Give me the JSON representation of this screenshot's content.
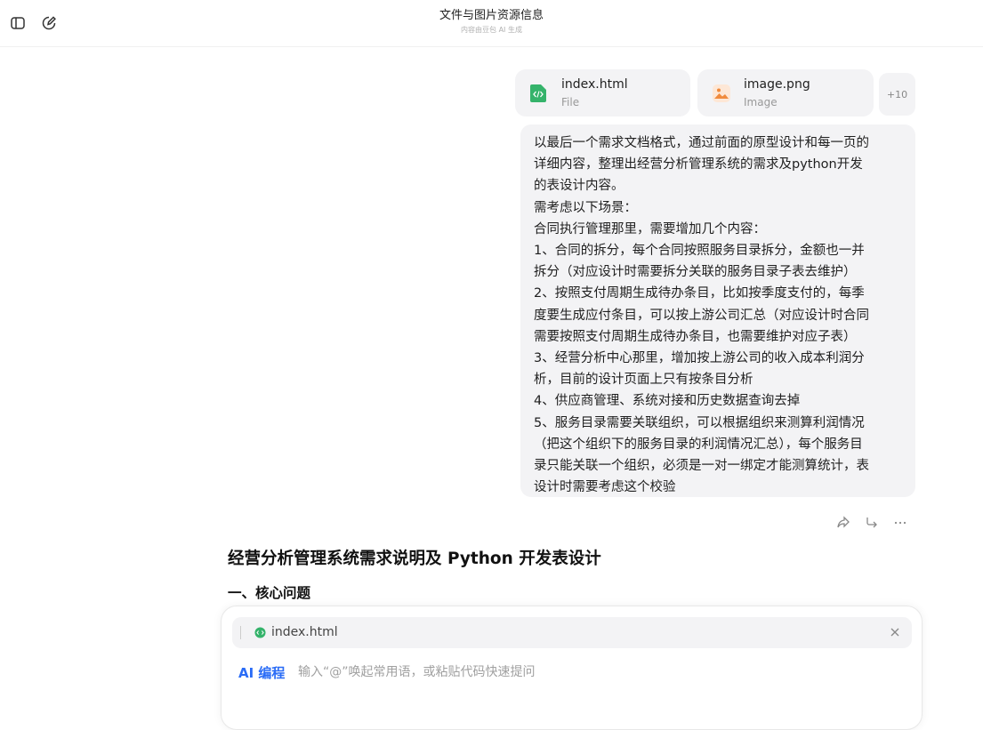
{
  "header": {
    "title": "文件与图片资源信息",
    "subtitle": "内容由豆包 AI 生成"
  },
  "attachments": [
    {
      "name": "index.html",
      "type": "File",
      "icon": "html-file-icon",
      "color": "#35b36b"
    },
    {
      "name": "image.png",
      "type": "Image",
      "icon": "image-file-icon",
      "color": "#f08a3c"
    }
  ],
  "more_count": "+10",
  "user_message": {
    "lines": [
      "以最后一个需求文档格式，通过前面的原型设计和每一页的",
      "详细内容，整理出经营分析管理系统的需求及python开发",
      "的表设计内容。",
      "需考虑以下场景：",
      "合同执行管理那里，需要增加几个内容：",
      "1、合同的拆分，每个合同按照服务目录拆分，金额也一并",
      "拆分（对应设计时需要拆分关联的服务目录子表去维护）",
      "2、按照支付周期生成待办条目，比如按季度支付的，每季",
      "度要生成应付条目，可以按上游公司汇总（对应设计时合同",
      "需要按照支付周期生成待办条目，也需要维护对应子表）",
      "3、经营分析中心那里，增加按上游公司的收入成本利润分",
      "析，目前的设计页面上只有按条目分析",
      "4、供应商管理、系统对接和历史数据查询去掉",
      "5、服务目录需要关联组织，可以根据组织来测算利润情况",
      "（把这个组织下的服务目录的利润情况汇总），每个服务目",
      "录只能关联一个组织，必须是一对一绑定才能测算统计，表",
      "设计时需要考虑这个校验"
    ]
  },
  "answer": {
    "title": "经营分析管理系统需求说明及 Python 开发表设计",
    "section1": "一、核心问题"
  },
  "composer": {
    "attached_file": "index.html",
    "mode_label": "AI 编程",
    "placeholder": "输入“@”唤起常用语，或粘贴代码快速提问"
  },
  "colors": {
    "accent": "#2a6cf6",
    "bubble_bg": "#f3f3f5"
  }
}
